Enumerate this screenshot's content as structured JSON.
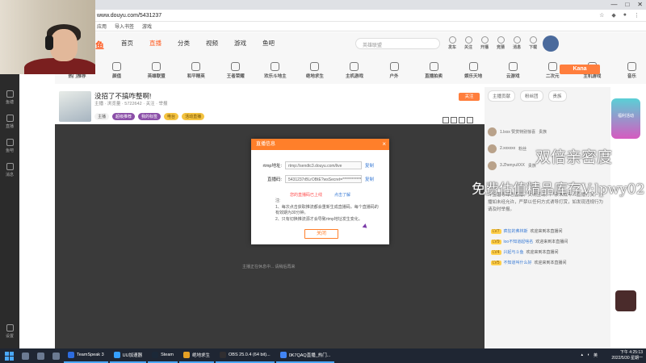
{
  "browser": {
    "url": "www.douyu.com/5431237",
    "bookmarks": [
      "应用",
      "导入书签",
      "游戏"
    ]
  },
  "site": {
    "logo": "鱼",
    "nav": [
      "首页",
      "直播",
      "分类",
      "视频",
      "游戏",
      "鱼吧"
    ],
    "nav_active_index": 1,
    "search_placeholder": "英雄联盟",
    "header_icons": [
      "发车",
      "关注",
      "开播",
      "竞猜",
      "消息",
      "下载"
    ],
    "categories": [
      "热门推荐",
      "颜值",
      "英雄联盟",
      "和平精英",
      "王者荣耀",
      "欢乐斗地主",
      "绝地求生",
      "主机游戏",
      "户外",
      "直播拍卖",
      "娱乐天地",
      "云游戏",
      "二次元",
      "主机游戏",
      "音乐",
      "更多"
    ],
    "kana_label": "Kana"
  },
  "sidebar": {
    "items": [
      "鱼塘",
      "直播",
      "鱼吧",
      "消息",
      "设置"
    ]
  },
  "room": {
    "title": "没招了不搞咋整啊!",
    "meta": "主播 · 浏览量 · 5722642 · 关注 · 举报",
    "tags": [
      "主播",
      "超级推荐",
      "我的标签",
      "电台",
      "活动直播"
    ],
    "follow_label": "关注"
  },
  "video": {
    "placeholder": "主播正在休息中... 请稍后再来"
  },
  "right_panel": {
    "tabs": [
      "主播贡献",
      "粉丝团",
      "贵族"
    ],
    "rank": [
      {
        "name": "1.lxxx 赞赏特别惊喜",
        "badge": "贵族"
      },
      {
        "name": "2.xxxxxx",
        "badge": "粉丝"
      },
      {
        "name": "3.ZhenyuXXX",
        "badge": "贵族"
      }
    ],
    "notice": "斗鱼倡导绿色直播、文明互动。严禁未成年人直播打赏。主播如未经允许，严禁以任何方式诱导打赏，如发现违规行为请及时举报。",
    "chat": [
      {
        "lv": "LV7",
        "name": "疯狂的弗林斯",
        "text": "欢迎来到本直播间"
      },
      {
        "lv": "LV9",
        "name": "loo不知道起啥名",
        "text": "欢迎来到本直播间"
      },
      {
        "lv": "LV4",
        "name": "兴起与斗鱼",
        "text": "欢迎来到本直播间"
      },
      {
        "lv": "LV5",
        "name": "不知道叫什么好",
        "text": "欢迎来到本直播间"
      },
      {
        "lv": "LV3",
        "name": "路人甲乙丙丁",
        "text": "欢迎来到本直播间"
      }
    ]
  },
  "promo": {
    "label": "福利活动"
  },
  "watermark": {
    "line1": "双倍亲密度",
    "line2": "免费估值精品库存V:lpwy02"
  },
  "modal": {
    "title": "直播信息",
    "close": "×",
    "rtmp_label": "rtmp地址:",
    "rtmp_value": "rtmp://sendtc3.douyu.com/live",
    "code_label": "直播码:",
    "code_value": "5431237rBLrOBtE?wsSecret=**************",
    "copy": "复制",
    "hint_red": "您的直播码已上线",
    "hint_blue": "点击了解",
    "note_title": "注:",
    "note_1": "1、每次点击获取推流都会重新生成直播码，每个直播码的有效期为30分钟。",
    "note_2": "2、只有切换推流源才会导致rtmp地址发生变化。",
    "ok_button": "关闭"
  },
  "taskbar": {
    "apps": [
      "TeamSpeak 3",
      "UU加速器",
      "Steam",
      "绝地求生",
      "OBS 25.0.4 (64 bit)...",
      "0K7QAQ直播_热门..."
    ],
    "tray_lang": "英",
    "time": "下午 4:25:13",
    "date": "2022/5/30 星期一"
  }
}
